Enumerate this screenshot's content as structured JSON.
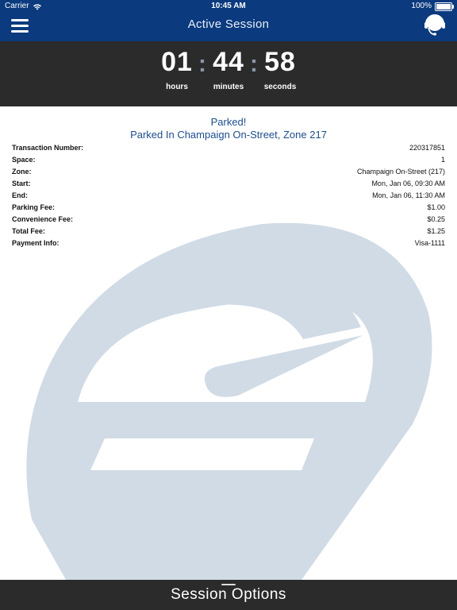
{
  "status_bar": {
    "carrier": "Carrier",
    "time": "10:45 AM",
    "battery": "100%"
  },
  "nav": {
    "title": "Active Session",
    "menu_icon": "hamburger-menu-icon",
    "support_icon": "headset-icon"
  },
  "timer": {
    "hours": "01",
    "hours_label": "hours",
    "minutes": "44",
    "minutes_label": "minutes",
    "seconds": "58",
    "seconds_label": "seconds",
    "separator": ":"
  },
  "banner": {
    "status": "Parked!",
    "location": "Parked In Champaign On-Street, Zone 217"
  },
  "details": [
    {
      "label": "Transaction Number:",
      "value": "220317851"
    },
    {
      "label": "Space:",
      "value": "1"
    },
    {
      "label": "Zone:",
      "value": "Champaign On-Street (217)"
    },
    {
      "label": "Start:",
      "value": "Mon, Jan 06, 09:30 AM"
    },
    {
      "label": "End:",
      "value": "Mon, Jan 06, 11:30 AM"
    },
    {
      "label": "Parking Fee:",
      "value": "$1.00"
    },
    {
      "label": "Convenience Fee:",
      "value": "$0.25"
    },
    {
      "label": "Total Fee:",
      "value": "$1.25"
    },
    {
      "label": "Payment Info:",
      "value": "Visa-1111"
    }
  ],
  "bottom": {
    "label": "Session Options"
  },
  "colors": {
    "nav": "#0b3a7e",
    "dark": "#2b2b2b",
    "accent": "#1e4d8c",
    "watermark": "#d1dbe6"
  }
}
